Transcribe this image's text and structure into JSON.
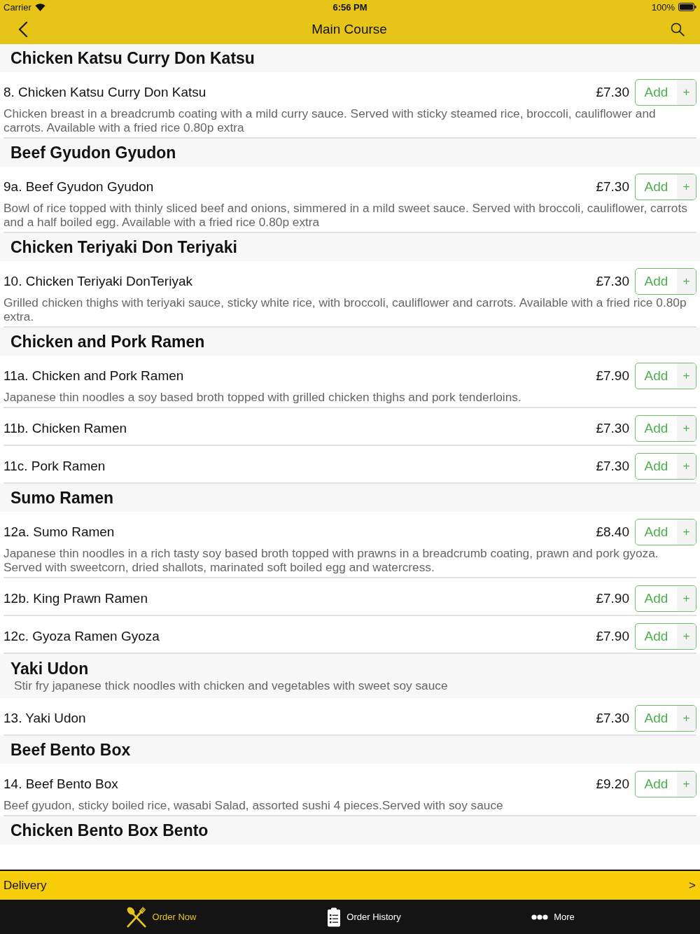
{
  "status_bar": {
    "carrier": "Carrier",
    "time": "6:56 PM",
    "battery": "100%"
  },
  "nav_bar": {
    "title": "Main Course"
  },
  "sections": [
    {
      "title": "Chicken Katsu Curry Don Katsu",
      "items": [
        {
          "name": "8. Chicken Katsu Curry Don Katsu",
          "price": "£7.30",
          "add_label": "Add",
          "plus_label": "+",
          "description": "Chicken breast in a breadcrumb coating with a mild curry sauce. Served with sticky steamed rice, broccoli, cauliflower and carrots. Available with a fried rice 0.80p extra"
        }
      ]
    },
    {
      "title": "Beef Gyudon Gyudon",
      "items": [
        {
          "name": "9a. Beef Gyudon Gyudon",
          "price": "£7.30",
          "add_label": "Add",
          "plus_label": "+",
          "description": "Bowl of rice topped with thinly sliced beef and onions, simmered in a mild sweet sauce. Served with broccoli, cauliflower, carrots and a half boiled egg. Available with a fried rice 0.80p extra"
        }
      ]
    },
    {
      "title": "Chicken Teriyaki Don Teriyaki",
      "items": [
        {
          "name": "10. Chicken Teriyaki DonTeriyak",
          "price": "£7.30",
          "add_label": "Add",
          "plus_label": "+",
          "description": "Grilled chicken thighs with teriyaki sauce, sticky white rice, with broccoli, cauliflower and carrots. Available with a fried rice 0.80p extra."
        }
      ]
    },
    {
      "title": "Chicken and Pork Ramen",
      "items": [
        {
          "name": "11a. Chicken and Pork Ramen",
          "price": "£7.90",
          "add_label": "Add",
          "plus_label": "+",
          "description": "Japanese thin noodles a soy based broth topped with grilled chicken thighs and pork tenderloins."
        },
        {
          "name": "11b. Chicken Ramen",
          "price": "£7.30",
          "add_label": "Add",
          "plus_label": "+"
        },
        {
          "name": "11c. Pork Ramen",
          "price": "£7.30",
          "add_label": "Add",
          "plus_label": "+"
        }
      ]
    },
    {
      "title": "Sumo Ramen",
      "items": [
        {
          "name": "12a. Sumo Ramen",
          "price": "£8.40",
          "add_label": "Add",
          "plus_label": "+",
          "description": "Japanese thin noodles in a rich tasty soy based broth topped with prawns in a breadcrumb coating, prawn and pork gyoza. Served with sweetcorn, dried shallots, marinated soft boiled egg and watercress."
        },
        {
          "name": "12b. King Prawn Ramen",
          "price": "£7.90",
          "add_label": "Add",
          "plus_label": "+"
        },
        {
          "name": "12c. Gyoza Ramen Gyoza",
          "price": "£7.90",
          "add_label": "Add",
          "plus_label": "+"
        }
      ]
    },
    {
      "title": "Yaki Udon",
      "description": "Stir fry japanese thick noodles with chicken and vegetables with sweet soy sauce",
      "items": [
        {
          "name": "13. Yaki Udon",
          "price": "£7.30",
          "add_label": "Add",
          "plus_label": "+"
        }
      ]
    },
    {
      "title": "Beef Bento Box",
      "items": [
        {
          "name": "14. Beef Bento Box",
          "price": "£9.20",
          "add_label": "Add",
          "plus_label": "+",
          "description": "Beef gyudon, sticky boiled rice, wasabi Salad, assorted sushi 4 pieces.Served with soy sauce"
        }
      ]
    },
    {
      "title": "Chicken Bento Box Bento"
    }
  ],
  "delivery_bar": {
    "label": "Delivery",
    "arrow": ">"
  },
  "tab_bar": [
    {
      "kind": "cutlery",
      "label": "Order Now",
      "selected": true
    },
    {
      "kind": "clipboard",
      "label": "Order History",
      "selected": false
    },
    {
      "kind": "dots",
      "label": "More",
      "selected": false
    }
  ]
}
